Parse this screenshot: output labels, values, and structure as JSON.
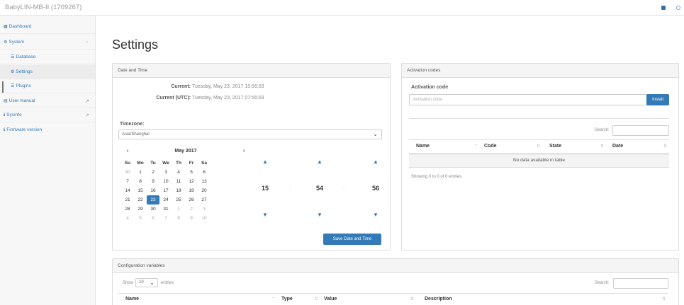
{
  "header": {
    "brand": "BabyLIN-MB-II (1709267)"
  },
  "sidebar": {
    "items": [
      {
        "label": "Dashboard",
        "icon": "dashboard-icon"
      },
      {
        "label": "System",
        "icon": "cogs-icon",
        "caret": "‹"
      },
      {
        "label": "Database",
        "icon": "list-icon"
      },
      {
        "label": "Settings",
        "icon": "cogs-icon"
      },
      {
        "label": "Plugins",
        "icon": "list-icon"
      },
      {
        "label": "User manual",
        "icon": "book-icon",
        "ext": "↗"
      },
      {
        "label": "Sysinfo",
        "icon": "info-icon",
        "ext": "↗"
      },
      {
        "label": "Firmware version",
        "icon": "info-icon"
      }
    ]
  },
  "page": {
    "title": "Settings"
  },
  "datetime": {
    "heading": "Date and Time",
    "current_label": "Current:",
    "current_value": "Tuesday, May 23, 2017 15:56:03",
    "utc_label": "Current (UTC):",
    "utc_value": "Tuesday, May 23, 2017 07:56:03",
    "timezone_label": "Timezone:",
    "timezone_value": "Asia/Shanghai",
    "calendar": {
      "prev": "‹",
      "next": "›",
      "month": "May 2017",
      "dow": [
        "Su",
        "Mo",
        "Tu",
        "We",
        "Th",
        "Fr",
        "Sa"
      ],
      "weeks": [
        [
          "30",
          "1",
          "2",
          "3",
          "4",
          "5",
          "6"
        ],
        [
          "7",
          "8",
          "9",
          "10",
          "11",
          "12",
          "13"
        ],
        [
          "14",
          "15",
          "16",
          "17",
          "18",
          "19",
          "20"
        ],
        [
          "21",
          "22",
          "23",
          "24",
          "25",
          "26",
          "27"
        ],
        [
          "28",
          "29",
          "30",
          "31",
          "1",
          "2",
          "3"
        ],
        [
          "4",
          "5",
          "6",
          "7",
          "8",
          "9",
          "10"
        ]
      ]
    },
    "time": {
      "hours": "15",
      "minutes": "54",
      "seconds": "56",
      "separator": ":",
      "up": "▲",
      "down": "▼"
    },
    "save_button": "Save Date and Time"
  },
  "activation": {
    "heading": "Activation codes",
    "field_label": "Activation code",
    "placeholder": "Activation code",
    "install_button": "Install",
    "search_label": "Search:",
    "columns": [
      "Name",
      "Code",
      "State",
      "Date"
    ],
    "empty": "No data available in table",
    "info": "Showing 0 to 0 of 0 entries"
  },
  "config": {
    "heading": "Configuration variables",
    "show_label": "Show",
    "page_size": "10",
    "entries_label": "entries",
    "search_label": "Search:",
    "columns": [
      "Name",
      "Type",
      "Value",
      "Description"
    ]
  }
}
